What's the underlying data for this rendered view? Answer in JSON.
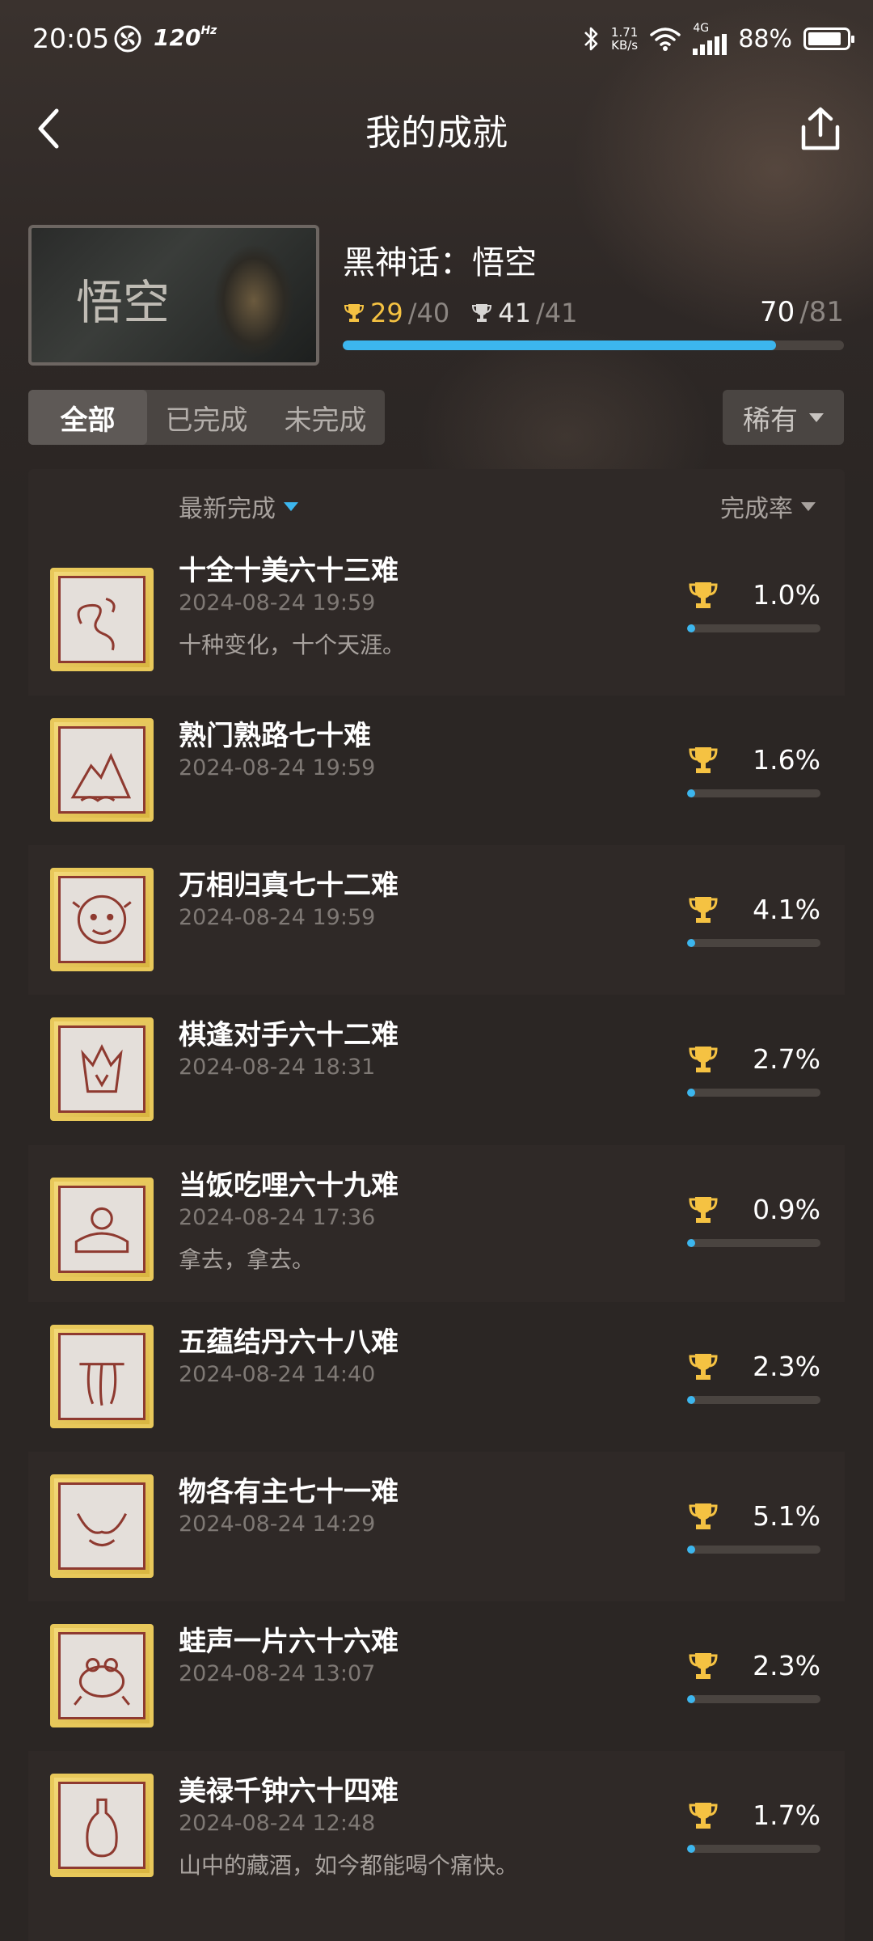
{
  "status_bar": {
    "time": "20:05",
    "refresh_rate": "120",
    "refresh_unit": "Hz",
    "net_speed_value": "1.71",
    "net_speed_unit": "KB/s",
    "network_type": "4G",
    "battery_percent": "88%",
    "battery_level": 0.88
  },
  "header": {
    "title": "我的成就",
    "back_icon": "chevron-left-icon",
    "share_icon": "share-icon"
  },
  "game": {
    "title": "黑神话：悟空",
    "cover_text": "悟空",
    "gold_count": "29",
    "gold_total": "/40",
    "silver_count": "41",
    "silver_total": "/41",
    "earned": "70",
    "total": "/81",
    "progress": 0.864
  },
  "tabs": [
    {
      "label": "全部",
      "active": true
    },
    {
      "label": "已完成",
      "active": false
    },
    {
      "label": "未完成",
      "active": false
    }
  ],
  "filter": {
    "label": "稀有"
  },
  "sort": {
    "latest_label": "最新完成",
    "rate_label": "完成率"
  },
  "achievements": [
    {
      "name": "十全十美六十三难",
      "date": "2024-08-24 19:59",
      "desc": "十种变化，十个天涯。",
      "rate": "1.0%",
      "rate_value": 1.0,
      "icon": "swirl-icon"
    },
    {
      "name": "熟门熟路七十难",
      "date": "2024-08-24 19:59",
      "desc": "",
      "rate": "1.6%",
      "rate_value": 1.6,
      "icon": "mountain-icon"
    },
    {
      "name": "万相归真七十二难",
      "date": "2024-08-24 19:59",
      "desc": "",
      "rate": "4.1%",
      "rate_value": 4.1,
      "icon": "monkey-face-icon"
    },
    {
      "name": "棋逢对手六十二难",
      "date": "2024-08-24 18:31",
      "desc": "",
      "rate": "2.7%",
      "rate_value": 2.7,
      "icon": "crown-icon"
    },
    {
      "name": "当饭吃哩六十九难",
      "date": "2024-08-24 17:36",
      "desc": "拿去，拿去。",
      "rate": "0.9%",
      "rate_value": 0.9,
      "icon": "offering-icon"
    },
    {
      "name": "五蕴结丹六十八难",
      "date": "2024-08-24 14:40",
      "desc": "",
      "rate": "2.3%",
      "rate_value": 2.3,
      "icon": "staff-icon"
    },
    {
      "name": "物各有主七十一难",
      "date": "2024-08-24 14:29",
      "desc": "",
      "rate": "5.1%",
      "rate_value": 5.1,
      "icon": "horns-icon"
    },
    {
      "name": "蛙声一片六十六难",
      "date": "2024-08-24 13:07",
      "desc": "",
      "rate": "2.3%",
      "rate_value": 2.3,
      "icon": "frog-icon"
    },
    {
      "name": "美禄千钟六十四难",
      "date": "2024-08-24 12:48",
      "desc": "山中的藏酒，如今都能喝个痛快。",
      "rate": "1.7%",
      "rate_value": 1.7,
      "icon": "wine-vase-icon"
    }
  ],
  "colors": {
    "accent_blue": "#3cb6ee",
    "trophy_gold": "#f5c242",
    "badge_frame": "#e8c85a",
    "badge_line": "#8e3a30"
  }
}
